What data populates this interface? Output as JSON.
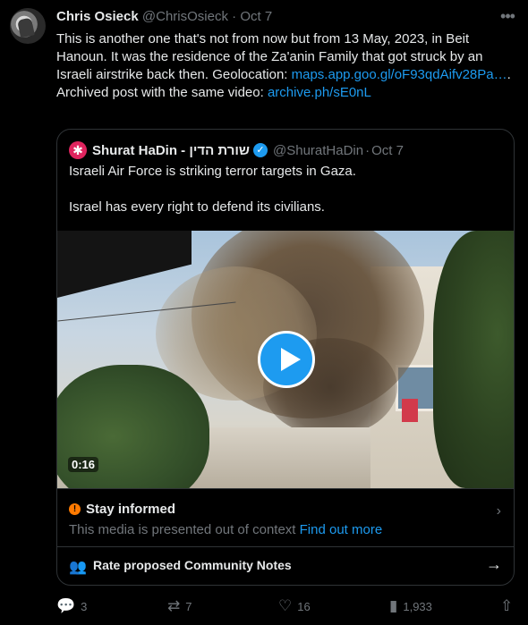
{
  "post": {
    "author_name": "Chris Osieck",
    "author_handle": "@ChrisOsieck",
    "separator": "·",
    "time": "Oct 7",
    "text_part1": "This is another one that's not from now but from 13 May, 2023, in Beit Hanoun. It was the residence of the Za'anin Family that got struck by an Israeli airstrike back then. Geolocation: ",
    "link1": "maps.app.goo.gl/oF93qdAifv28Pa…",
    "text_part2": ". Archived post with the same video: ",
    "link2": "archive.ph/sE0nL"
  },
  "quoted": {
    "author_name": "Shurat HaDin - שורת הדין",
    "author_handle": "@ShuratHaDin",
    "separator": "·",
    "time": "Oct 7",
    "line1": "Israeli Air Force is striking terror targets in Gaza.",
    "line2": "Israel has every right to defend its civilians.",
    "video_duration": "0:16",
    "notice_title": "Stay informed",
    "notice_body": "This media is presented out of context ",
    "notice_link": "Find out more",
    "community_notes_label": "Rate proposed Community Notes"
  },
  "actions": {
    "replies": "3",
    "reposts": "7",
    "likes": "16",
    "views": "1,933"
  },
  "icons": {
    "more": "more-icon",
    "verified": "verified-badge-icon",
    "play": "play-icon",
    "warning": "warning-icon",
    "people": "people-icon",
    "arrow": "arrow-right-icon",
    "reply": "reply-icon",
    "repost": "repost-icon",
    "like": "heart-icon",
    "views": "views-icon",
    "share": "share-icon"
  },
  "colors": {
    "accent": "#1d9bf0",
    "warning": "#ff7a00",
    "background": "#000000"
  }
}
